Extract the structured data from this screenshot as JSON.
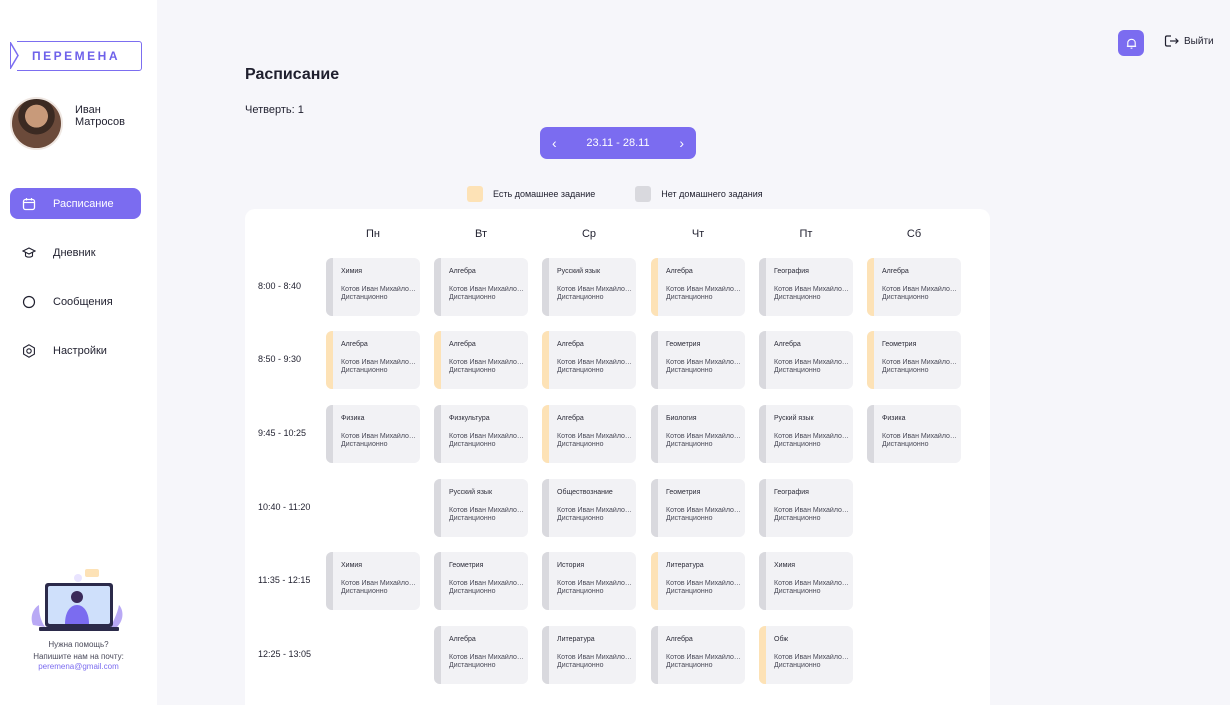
{
  "app": {
    "logo": "ПЕРЕМЕНА"
  },
  "profile": {
    "first_name": "Иван",
    "last_name": "Матросов"
  },
  "nav": [
    {
      "label": "Расписание",
      "icon": "calendar-icon",
      "active": true
    },
    {
      "label": "Дневник",
      "icon": "graduation-cap-icon",
      "active": false
    },
    {
      "label": "Сообщения",
      "icon": "chat-bubble-icon",
      "active": false
    },
    {
      "label": "Настройки",
      "icon": "gear-icon",
      "active": false
    }
  ],
  "help": {
    "line1": "Нужна помощь?",
    "line2": "Напишите нам на почту:",
    "email": "peremena@gmail.com"
  },
  "header": {
    "logout_label": "Выйти"
  },
  "page": {
    "title": "Расписание",
    "quarter": "Четверть: 1",
    "week_range": "23.11 - 28.11"
  },
  "legend": {
    "with_homework": "Есть домашнее задание",
    "no_homework": "Нет домашнего задания"
  },
  "colors": {
    "accent": "#7b6cf0",
    "homework": "#fde2b6",
    "no_homework": "#d9d9de"
  },
  "schedule": {
    "days": [
      "Пн",
      "Вт",
      "Ср",
      "Чт",
      "Пт",
      "Сб"
    ],
    "times": [
      "8:00 - 8:40",
      "8:50 - 9:30",
      "9:45 - 10:25",
      "10:40 - 11:20",
      "11:35 - 12:15",
      "12:25 - 13:05"
    ],
    "rows": [
      [
        {
          "subject": "Химия",
          "teacher": "Котов Иван Михайлович",
          "mode": "Дистанционно",
          "hw": false
        },
        {
          "subject": "Алгебра",
          "teacher": "Котов Иван Михайлович",
          "mode": "Дистанционно",
          "hw": false
        },
        {
          "subject": "Русский язык",
          "teacher": "Котов Иван Михайлович",
          "mode": "Дистанционно",
          "hw": false
        },
        {
          "subject": "Алгебра",
          "teacher": "Котов Иван Михайлович",
          "mode": "Дистанционно",
          "hw": true
        },
        {
          "subject": "География",
          "teacher": "Котов Иван Михайлович",
          "mode": "Дистанционно",
          "hw": false
        },
        {
          "subject": "Алгебра",
          "teacher": "Котов Иван Михайлович",
          "mode": "Дистанционно",
          "hw": true
        }
      ],
      [
        {
          "subject": "Алгебра",
          "teacher": "Котов Иван Михайлович",
          "mode": "Дистанционно",
          "hw": true
        },
        {
          "subject": "Алгебра",
          "teacher": "Котов Иван Михайлович",
          "mode": "Дистанционно",
          "hw": true
        },
        {
          "subject": "Алгебра",
          "teacher": "Котов Иван Михайлович",
          "mode": "Дистанционно",
          "hw": true
        },
        {
          "subject": "Геометрия",
          "teacher": "Котов Иван Михайлович",
          "mode": "Дистанционно",
          "hw": false
        },
        {
          "subject": "Алгебра",
          "teacher": "Котов Иван Михайлович",
          "mode": "Дистанционно",
          "hw": false
        },
        {
          "subject": "Геометрия",
          "teacher": "Котов Иван Михайлович",
          "mode": "Дистанционно",
          "hw": true
        }
      ],
      [
        {
          "subject": "Физика",
          "teacher": "Котов Иван Михайлович",
          "mode": "Дистанционно",
          "hw": false
        },
        {
          "subject": "Физкультура",
          "teacher": "Котов Иван Михайлович",
          "mode": "Дистанционно",
          "hw": false
        },
        {
          "subject": "Алгебра",
          "teacher": "Котов Иван Михайлович",
          "mode": "Дистанционно",
          "hw": true
        },
        {
          "subject": "Биология",
          "teacher": "Котов Иван Михайлович",
          "mode": "Дистанционно",
          "hw": false
        },
        {
          "subject": "Руский язык",
          "teacher": "Котов Иван Михайлович",
          "mode": "Дистанционно",
          "hw": false
        },
        {
          "subject": "Физика",
          "teacher": "Котов Иван Михайлович",
          "mode": "Дистанционно",
          "hw": false
        }
      ],
      [
        null,
        {
          "subject": "Русский язык",
          "teacher": "Котов Иван Михайлович",
          "mode": "Дистанционно",
          "hw": false
        },
        {
          "subject": "Обществознание",
          "teacher": "Котов Иван Михайлович",
          "mode": "Дистанционно",
          "hw": false
        },
        {
          "subject": "Геометрия",
          "teacher": "Котов Иван Михайлович",
          "mode": "Дистанционно",
          "hw": false
        },
        {
          "subject": "География",
          "teacher": "Котов Иван Михайлович",
          "mode": "Дистанционно",
          "hw": false
        },
        null
      ],
      [
        {
          "subject": "Химия",
          "teacher": "Котов Иван Михайлович",
          "mode": "Дистанционно",
          "hw": false
        },
        {
          "subject": "Геометрия",
          "teacher": "Котов Иван Михайлович",
          "mode": "Дистанционно",
          "hw": false
        },
        {
          "subject": "История",
          "teacher": "Котов Иван Михайлович",
          "mode": "Дистанционно",
          "hw": false
        },
        {
          "subject": "Литература",
          "teacher": "Котов Иван Михайлович",
          "mode": "Дистанционно",
          "hw": true
        },
        {
          "subject": "Химия",
          "teacher": "Котов Иван Михайлович",
          "mode": "Дистанционно",
          "hw": false
        },
        null
      ],
      [
        null,
        {
          "subject": "Алгебра",
          "teacher": "Котов Иван Михайлович",
          "mode": "Дистанционно",
          "hw": false
        },
        {
          "subject": "Литература",
          "teacher": "Котов Иван Михайлович",
          "mode": "Дистанционно",
          "hw": false
        },
        {
          "subject": "Алгебра",
          "teacher": "Котов Иван Михайлович",
          "mode": "Дистанционно",
          "hw": false
        },
        {
          "subject": "Обж",
          "teacher": "Котов Иван Михайлович",
          "mode": "Дистанционно",
          "hw": true
        },
        null
      ]
    ]
  }
}
